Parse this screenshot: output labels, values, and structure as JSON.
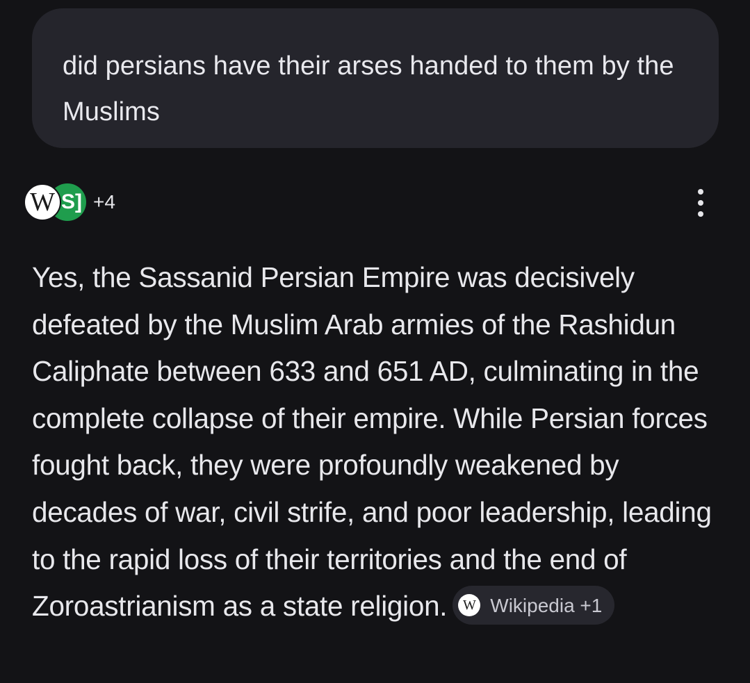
{
  "user_message": {
    "text": "did persians have their arses handed to them by the Muslims"
  },
  "sources": {
    "icons": [
      "wikipedia-icon",
      "s-source-icon"
    ],
    "wiki_glyph": "W",
    "s_glyph": "S]",
    "more_count": "+4"
  },
  "answer": {
    "text": "Yes, the Sassanid Persian Empire was decisively defeated by the Muslim Arab armies of the Rashidun Caliphate between 633 and 651 AD, culminating in the complete collapse of their empire. While Persian forces fought back, they were profoundly weakened by decades of war, civil strife, and poor leadership, leading to the rapid loss of their territories and the end of Zoroastrianism as a state religion.",
    "citation_chip": {
      "glyph": "W",
      "label": "Wikipedia +1"
    }
  },
  "colors": {
    "background": "#131316",
    "bubble": "#25252c",
    "chip": "#27272e",
    "s_source_green": "#1f9d4d",
    "text": "#e8e8ec"
  }
}
